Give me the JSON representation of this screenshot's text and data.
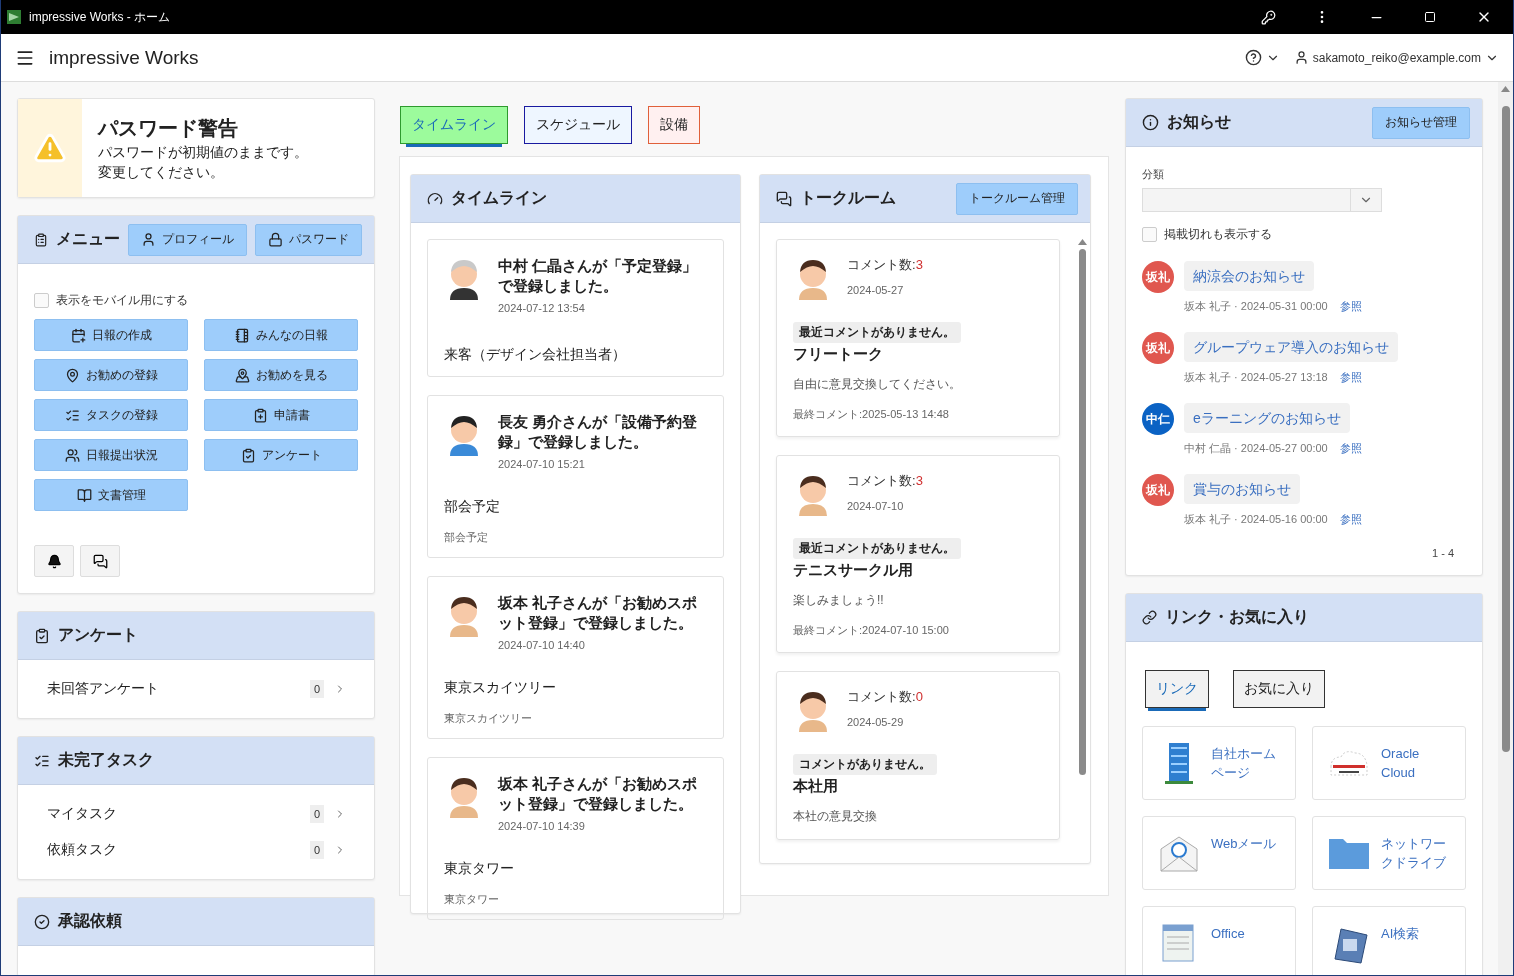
{
  "window": {
    "title": "impressive Works - ホーム"
  },
  "header": {
    "app_name": "impressive Works",
    "user": "sakamoto_reiko@example.com"
  },
  "password_warning": {
    "title": "パスワード警告",
    "lines": [
      "パスワードが初期値のままです。",
      "変更してください。"
    ]
  },
  "menu": {
    "title": "メニュー",
    "header_buttons": [
      "プロフィール",
      "パスワード"
    ],
    "mobile_toggle": {
      "label": "表示をモバイル用にする",
      "checked": false
    },
    "buttons": [
      "日報の作成",
      "みんなの日報",
      "お勧めの登録",
      "お勧めを見る",
      "タスクの登録",
      "申請書",
      "日報提出状況",
      "アンケート",
      "文書管理"
    ]
  },
  "survey": {
    "title": "アンケート",
    "items": [
      {
        "label": "未回答アンケート",
        "count": "0"
      }
    ]
  },
  "tasks": {
    "title": "未完了タスク",
    "items": [
      {
        "label": "マイタスク",
        "count": "0"
      },
      {
        "label": "依頼タスク",
        "count": "0"
      }
    ]
  },
  "approval": {
    "title": "承認依頼"
  },
  "tabs": [
    {
      "label": "タイムライン",
      "selected": true,
      "color": "#2e9a2e"
    },
    {
      "label": "スケジュール",
      "selected": false,
      "color": "#1a1aa0"
    },
    {
      "label": "設備",
      "selected": false,
      "color": "#e0603a"
    }
  ],
  "timeline": {
    "title": "タイムライン",
    "posts": [
      {
        "headline": "中村 仁晶さんが「予定登録」で登録しました。",
        "time": "2024-07-12 13:54",
        "subject": "来客（デザイン会社担当者）"
      },
      {
        "headline": "長友 勇介さんが「設備予約登録」で登録しました。",
        "time": "2024-07-10 15:21",
        "subject": "部会予定",
        "detail": "部会予定"
      },
      {
        "headline": "坂本 礼子さんが「お勧めスポット登録」で登録しました。",
        "time": "2024-07-10 14:40",
        "subject": "東京スカイツリー",
        "detail": "東京スカイツリー"
      },
      {
        "headline": "坂本 礼子さんが「お勧めスポット登録」で登録しました。",
        "time": "2024-07-10 14:39",
        "subject": "東京タワー",
        "detail": "東京タワー"
      }
    ]
  },
  "talkroom": {
    "title": "トークルーム",
    "button": "トークルーム管理",
    "rooms": [
      {
        "count_label": "コメント数:",
        "count": "3",
        "date": "2024-05-27",
        "badge": "最近コメントがありません。",
        "name": "フリートーク",
        "description": "自由に意見交換してください。",
        "last_comment": "最終コメント:2025-05-13 14:48"
      },
      {
        "count_label": "コメント数:",
        "count": "3",
        "date": "2024-07-10",
        "badge": "最近コメントがありません。",
        "name": "テニスサークル用",
        "description": "楽しみましょう!!",
        "last_comment": "最終コメント:2024-07-10 15:00"
      },
      {
        "count_label": "コメント数:",
        "count": "0",
        "date": "2024-05-29",
        "badge": "コメントがありません。",
        "name": "本社用",
        "description": "本社の意見交換"
      }
    ]
  },
  "notices": {
    "title": "お知らせ",
    "button": "お知らせ管理",
    "filter_label": "分類",
    "show_expired": {
      "label": "掲載切れも表示する",
      "checked": false
    },
    "items": [
      {
        "avatar": "坂礼",
        "color": "#e0574f",
        "title": "納涼会のお知らせ",
        "meta": "坂本 礼子 · 2024-05-31 00:00",
        "link": "参照"
      },
      {
        "avatar": "坂礼",
        "color": "#e0574f",
        "title": "グループウェア導入のお知らせ",
        "meta": "坂本 礼子 · 2024-05-27 13:18",
        "link": "参照"
      },
      {
        "avatar": "中仁",
        "color": "#0a62c4",
        "title": "eラーニングのお知らせ",
        "meta": "中村 仁晶 · 2024-05-27 00:00",
        "link": "参照"
      },
      {
        "avatar": "坂礼",
        "color": "#e0574f",
        "title": "賞与のお知らせ",
        "meta": "坂本 礼子 · 2024-05-16 00:00",
        "link": "参照"
      }
    ],
    "pagination": "1 - 4"
  },
  "links": {
    "title": "リンク・お気に入り",
    "tabs": [
      {
        "label": "リンク",
        "selected": true
      },
      {
        "label": "お気に入り",
        "selected": false
      }
    ],
    "items": [
      "自社ホームページ",
      "Oracle Cloud",
      "Webメール",
      "ネットワークドライブ",
      "Office",
      "AI検索"
    ]
  }
}
